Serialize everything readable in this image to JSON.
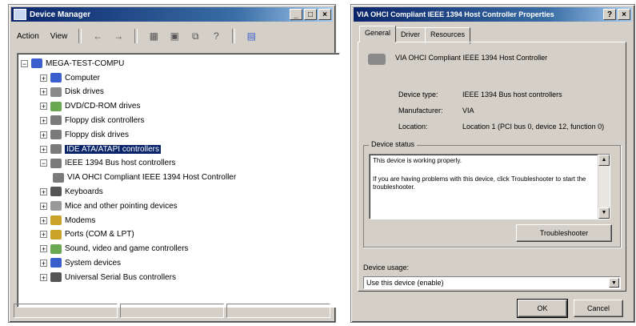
{
  "device_manager": {
    "title": "Device Manager",
    "menu": {
      "action": "Action",
      "view": "View"
    },
    "tree": {
      "root": "MEGA-TEST-COMPU",
      "items": [
        {
          "label": "Computer",
          "icon": "computer-icon",
          "color": "#3a5fcd",
          "expanded": false
        },
        {
          "label": "Disk drives",
          "icon": "disk-drive-icon",
          "color": "#8a8a8a",
          "expanded": false
        },
        {
          "label": "DVD/CD-ROM drives",
          "icon": "cdrom-icon",
          "color": "#6aa84f",
          "expanded": false
        },
        {
          "label": "Floppy disk controllers",
          "icon": "controller-icon",
          "color": "#7a7a7a",
          "expanded": false
        },
        {
          "label": "Floppy disk drives",
          "icon": "floppy-icon",
          "color": "#7a7a7a",
          "expanded": false
        },
        {
          "label": "IDE ATA/ATAPI controllers",
          "icon": "ide-controller-icon",
          "color": "#7a7a7a",
          "expanded": false,
          "selected": true
        },
        {
          "label": "IEEE 1394 Bus host controllers",
          "icon": "ieee1394-icon",
          "color": "#7a7a7a",
          "expanded": true
        },
        {
          "label": "VIA OHCI Compliant IEEE 1394 Host Controller",
          "icon": "ieee1394-device-icon",
          "color": "#7a7a7a",
          "child": true
        },
        {
          "label": "Keyboards",
          "icon": "keyboard-icon",
          "color": "#555555",
          "expanded": false
        },
        {
          "label": "Mice and other pointing devices",
          "icon": "mouse-icon",
          "color": "#999999",
          "expanded": false
        },
        {
          "label": "Modems",
          "icon": "modem-icon",
          "color": "#c9a227",
          "expanded": false
        },
        {
          "label": "Ports (COM & LPT)",
          "icon": "port-icon",
          "color": "#c9a227",
          "expanded": false
        },
        {
          "label": "Sound, video and game controllers",
          "icon": "sound-icon",
          "color": "#6aa84f",
          "expanded": false
        },
        {
          "label": "System devices",
          "icon": "system-devices-icon",
          "color": "#3a5fcd",
          "expanded": false
        },
        {
          "label": "Universal Serial Bus controllers",
          "icon": "usb-icon",
          "color": "#555555",
          "expanded": false
        }
      ]
    }
  },
  "properties": {
    "title": "VIA OHCI Compliant IEEE 1394 Host Controller Properties",
    "tabs": [
      "General",
      "Driver",
      "Resources"
    ],
    "device_name": "VIA OHCI Compliant IEEE 1394 Host Controller",
    "fields": [
      {
        "label": "Device type:",
        "value": "IEEE 1394 Bus host controllers"
      },
      {
        "label": "Manufacturer:",
        "value": "VIA"
      },
      {
        "label": "Location:",
        "value": "Location 1 (PCI bus 0, device 12, function 0)"
      }
    ],
    "status_group": "Device status",
    "status_line1": "This device is working properly.",
    "status_line2": "If you are having problems with this device, click Troubleshooter to start the troubleshooter.",
    "troubleshooter": "Troubleshooter",
    "usage_label": "Device usage:",
    "usage_value": "Use this device (enable)",
    "ok": "OK",
    "cancel": "Cancel"
  }
}
